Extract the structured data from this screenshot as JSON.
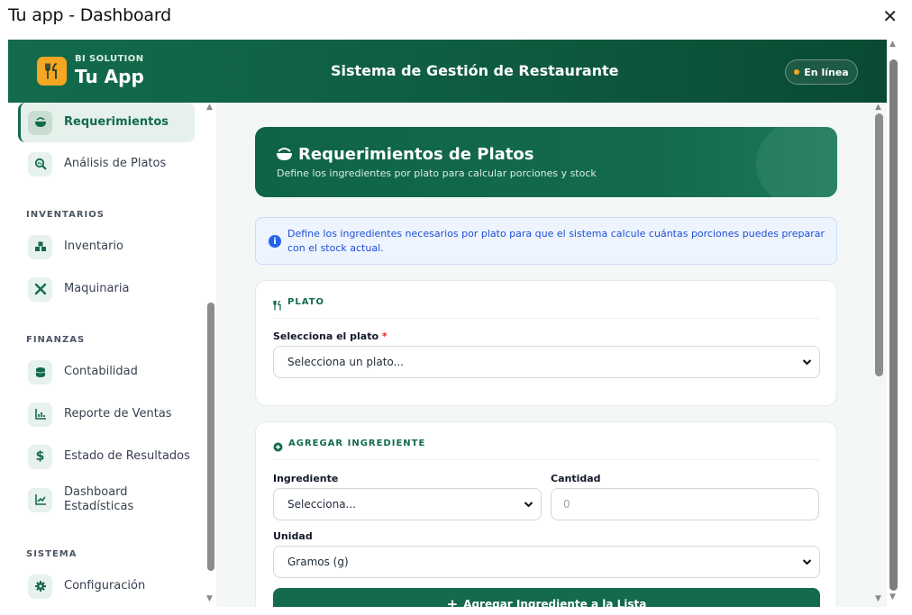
{
  "window": {
    "title": "Tu app - Dashboard",
    "close_glyph": "✕"
  },
  "header": {
    "brand_sub": "BI SOLUTION",
    "brand_name": "Tu App",
    "title": "Sistema de Gestión de Restaurante",
    "status": "En línea",
    "logo_icon": "utensils-icon",
    "accent_color": "#136b4c",
    "logo_color": "#f5a623"
  },
  "sidebar": {
    "items_top": [
      {
        "label": "Requerimientos",
        "icon": "bowl-icon",
        "active": true
      },
      {
        "label": "Análisis de Platos",
        "icon": "magnifier-chart-icon",
        "active": false
      }
    ],
    "sections": [
      {
        "label": "INVENTARIOS",
        "items": [
          {
            "label": "Inventario",
            "icon": "boxes-icon"
          },
          {
            "label": "Maquinaria",
            "icon": "tools-icon"
          }
        ]
      },
      {
        "label": "FINANZAS",
        "items": [
          {
            "label": "Contabilidad",
            "icon": "coins-icon"
          },
          {
            "label": "Reporte de Ventas",
            "icon": "bar-chart-icon"
          },
          {
            "label": "Estado de Resultados",
            "icon": "dollar-icon"
          },
          {
            "label": "Dashboard Estadísticas",
            "icon": "line-chart-icon"
          }
        ]
      },
      {
        "label": "SISTEMA",
        "items": [
          {
            "label": "Configuración",
            "icon": "gear-icon"
          }
        ]
      }
    ]
  },
  "banner": {
    "title": "Requerimientos de Platos",
    "subtitle": "Define los ingredientes por plato para calcular porciones y stock"
  },
  "info": {
    "text": "Define los ingredientes necesarios por plato para que el sistema calcule cuántas porciones puedes preparar con el stock actual."
  },
  "plato_card": {
    "heading": "PLATO",
    "field_label": "Selecciona el plato",
    "required_mark": "*",
    "select_value": "Selecciona un plato..."
  },
  "ingrediente_card": {
    "heading": "AGREGAR INGREDIENTE",
    "ingrediente_label": "Ingrediente",
    "ingrediente_value": "Selecciona...",
    "cantidad_label": "Cantidad",
    "cantidad_placeholder": "0",
    "unidad_label": "Unidad",
    "unidad_value": "Gramos (g)",
    "add_button": "Agregar Ingrediente a la Lista"
  }
}
